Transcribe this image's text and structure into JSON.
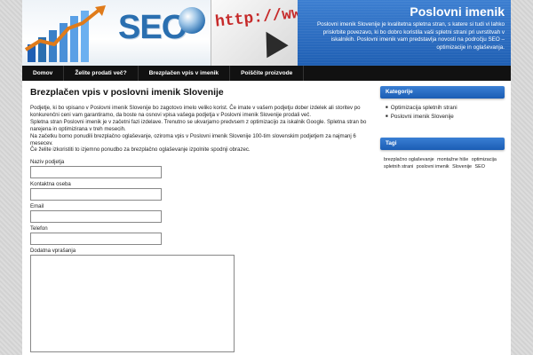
{
  "header": {
    "seo_text": "SEO",
    "http_text": "http://www",
    "site_title": "Poslovni imenik",
    "site_description": "Poslovni imenik Slovenije je kvalitetna spletna stran, s katere si tudi vi lahko priskrbite povezavo, ki bo dobro koristila vaši spletni strani pri uvrstitvah v iskalnikih. Poslovni imenik vam predstavlja novosti na področju SEO – optimizacije in oglaševanja."
  },
  "nav": {
    "items": [
      {
        "label": "Domov"
      },
      {
        "label": "Želite prodati več?"
      },
      {
        "label": "Brezplačen vpis v imenik"
      },
      {
        "label": "Poiščite proizvode"
      }
    ]
  },
  "main": {
    "title": "Brezplačen vpis v poslovni imenik Slovenije",
    "paragraphs": [
      "Podjetje, ki bo vpisano v Poslovni imenik Slovenije bo zagotovo imelo veliko korist. Če imate v vašem podjetju dober izdelek ali storitev po konkurenčni ceni vam garantiramo, da boste na osnovi vpisa vašega podjetja v Poslovni imenik Slovenije prodali več.",
      "Spletna stran Poslovni imenik je v začetni fazi izdelave. Trenutno se ukvarjamo predvsem z optimizacijo za iskalnik Google. Spletna stran bo narejena in optimizirana v treh mesecih.",
      "Na začetku bomo ponudili brezplačno oglaševanje, oziroma vpis v Poslovni imenik Slovenije 100-tim slovenskim podjetjem za najmanj 6 mesecev.",
      "Če želite izkoristiti to izjemno ponudbo za brezplačno oglaševanje izpolnite spodnji obrazec."
    ],
    "form": {
      "company_label": "Naziv podjetja",
      "company_value": "",
      "contact_label": "Kontaktna oseba",
      "contact_value": "",
      "email_label": "Email",
      "email_value": "",
      "phone_label": "Telefon",
      "phone_value": "",
      "questions_label": "Dodatna vprašanja",
      "questions_value": ""
    }
  },
  "sidebar": {
    "categories_title": "Kategorije",
    "categories": [
      {
        "label": "Optimizacija spletnih strani"
      },
      {
        "label": "Poslovni imenik Slovenije"
      }
    ],
    "tags_title": "Tagi",
    "tags": [
      {
        "label": "brezplačno oglaševanje"
      },
      {
        "label": "montažne hiše"
      },
      {
        "label": "optimizacija"
      },
      {
        "label": "spletnih strani"
      },
      {
        "label": "poslovni imenik"
      },
      {
        "label": "Slovenije"
      },
      {
        "label": "SEO"
      }
    ]
  },
  "colors": {
    "accent_blue": "#2a6fb0",
    "nav_black": "#111111",
    "http_red": "#c62a2a"
  }
}
